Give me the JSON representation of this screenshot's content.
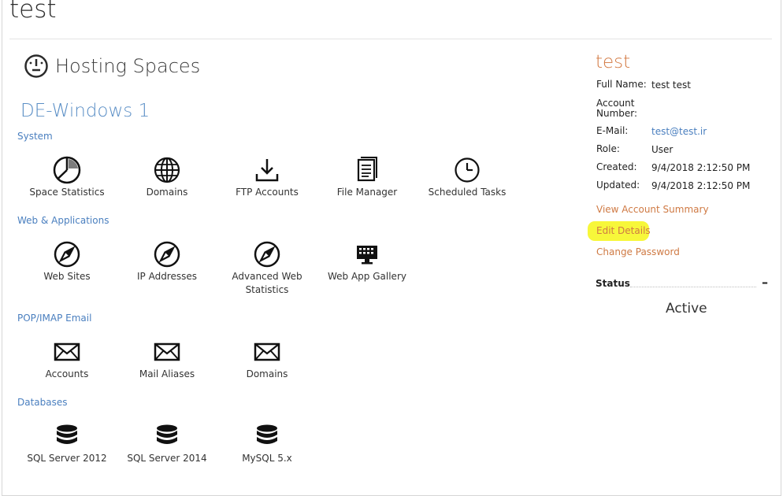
{
  "page_title": "test",
  "hosting": {
    "title": "Hosting Spaces",
    "space_name": "DE-Windows 1",
    "categories": [
      {
        "name": "System",
        "items": [
          {
            "label": "Space Statistics",
            "icon": "pie-chart-icon"
          },
          {
            "label": "Domains",
            "icon": "globe-icon"
          },
          {
            "label": "FTP Accounts",
            "icon": "download-icon"
          },
          {
            "label": "File Manager",
            "icon": "document-icon"
          },
          {
            "label": "Scheduled Tasks",
            "icon": "clock-icon"
          }
        ]
      },
      {
        "name": "Web & Applications",
        "items": [
          {
            "label": "Web Sites",
            "icon": "compass-icon"
          },
          {
            "label": "IP Addresses",
            "icon": "compass-icon"
          },
          {
            "label": "Advanced Web Statistics",
            "icon": "compass-icon"
          },
          {
            "label": "Web App Gallery",
            "icon": "monitor-icon"
          }
        ]
      },
      {
        "name": "POP/IMAP Email",
        "items": [
          {
            "label": "Accounts",
            "icon": "envelope-icon"
          },
          {
            "label": "Mail Aliases",
            "icon": "envelope-icon"
          },
          {
            "label": "Domains",
            "icon": "envelope-icon"
          }
        ]
      },
      {
        "name": "Databases",
        "items": [
          {
            "label": "SQL Server 2012",
            "icon": "database-icon"
          },
          {
            "label": "SQL Server 2014",
            "icon": "database-icon"
          },
          {
            "label": "MySQL 5.x",
            "icon": "database-icon"
          }
        ]
      }
    ]
  },
  "account": {
    "name": "test",
    "fields": [
      {
        "key": "Full Name:",
        "value": "test test"
      },
      {
        "key": "Account Number:",
        "value": ""
      },
      {
        "key": "E-Mail:",
        "value": "test@test.ir"
      },
      {
        "key": "Role:",
        "value": "User"
      },
      {
        "key": "Created:",
        "value": "9/4/2018 2:12:50 PM"
      },
      {
        "key": "Updated:",
        "value": "9/4/2018 2:12:50 PM"
      }
    ],
    "links": [
      "View Account Summary",
      "Edit Details",
      "Change Password"
    ],
    "status_label": "Status",
    "status_collapse": "–",
    "status_value": "Active"
  },
  "colors": {
    "link_blue": "#4a7fbf",
    "link_orange": "#cf7a44",
    "highlight": "#f7f73a"
  }
}
